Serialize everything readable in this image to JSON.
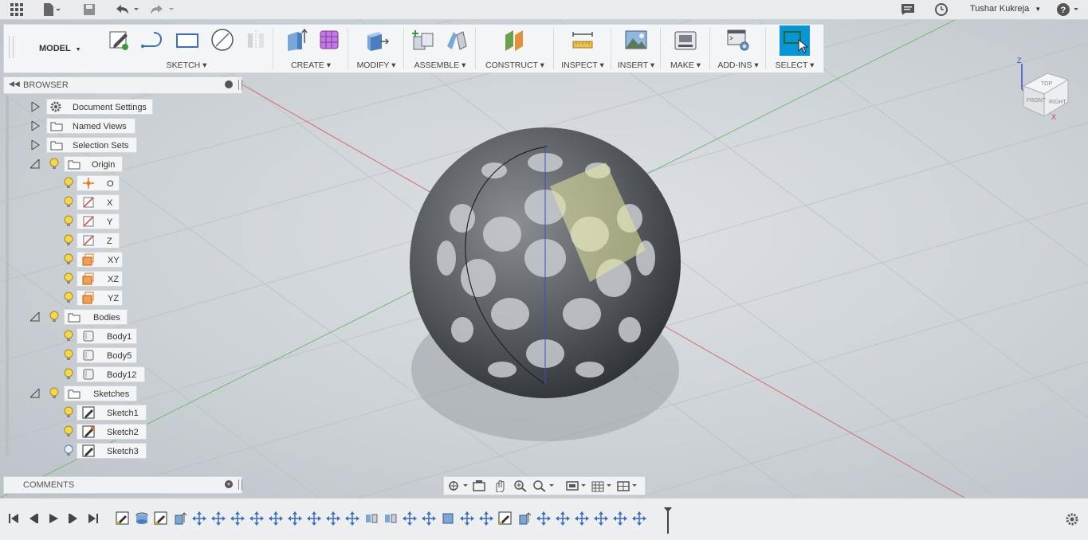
{
  "appbar": {
    "user_name": "Tushar Kukreja"
  },
  "toolbar": {
    "workspace": "MODEL",
    "groups": [
      {
        "label": "SKETCH"
      },
      {
        "label": "CREATE"
      },
      {
        "label": "MODIFY"
      },
      {
        "label": "ASSEMBLE"
      },
      {
        "label": "CONSTRUCT"
      },
      {
        "label": "INSPECT"
      },
      {
        "label": "INSERT"
      },
      {
        "label": "MAKE"
      },
      {
        "label": "ADD-INS"
      },
      {
        "label": "SELECT"
      }
    ]
  },
  "browser": {
    "title": "BROWSER",
    "nodes": [
      {
        "label": "Document Settings"
      },
      {
        "label": "Named Views"
      },
      {
        "label": "Selection Sets"
      },
      {
        "label": "Origin"
      },
      {
        "label": "O"
      },
      {
        "label": "X"
      },
      {
        "label": "Y"
      },
      {
        "label": "Z"
      },
      {
        "label": "XY"
      },
      {
        "label": "XZ"
      },
      {
        "label": "YZ"
      },
      {
        "label": "Bodies"
      },
      {
        "label": "Body1"
      },
      {
        "label": "Body5"
      },
      {
        "label": "Body12"
      },
      {
        "label": "Sketches"
      },
      {
        "label": "Sketch1"
      },
      {
        "label": "Sketch2"
      },
      {
        "label": "Sketch3"
      }
    ]
  },
  "comments": {
    "title": "COMMENTS"
  },
  "viewcube": {
    "top": "TOP",
    "front": "FRONT",
    "right": "RIGHT",
    "axis_z": "Z",
    "axis_x": "X"
  },
  "colors": {
    "accent": "#0696d7",
    "x_axis": "#e05050",
    "y_axis": "#50c050",
    "z_axis": "#3050d0"
  }
}
